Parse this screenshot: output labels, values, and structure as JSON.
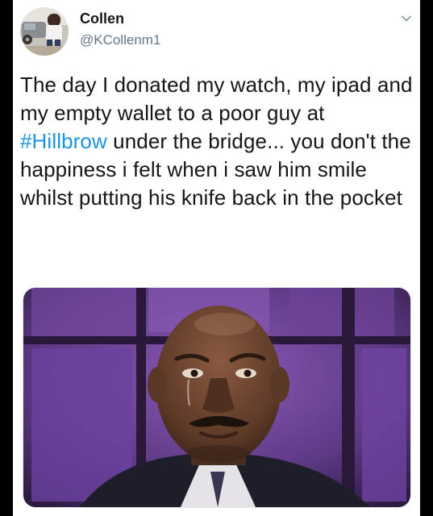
{
  "tweet": {
    "author": {
      "display_name": "Collen",
      "handle": "@KCollenm1",
      "avatar_icon": "user-avatar"
    },
    "menu_icon": "chevron-down-icon",
    "text_segments": {
      "before_hashtag": "The day I donated my watch, my ipad and my empty wallet to a poor guy at ",
      "hashtag": "#Hillbrow",
      "after_hashtag": " under the bridge... you don't the happiness i felt when i saw him smile whilst putting his knife back in the pocket"
    },
    "colors": {
      "hashtag": "#1b95e0",
      "text": "#14171a",
      "handle": "#657786"
    },
    "media": {
      "type": "photo"
    }
  }
}
